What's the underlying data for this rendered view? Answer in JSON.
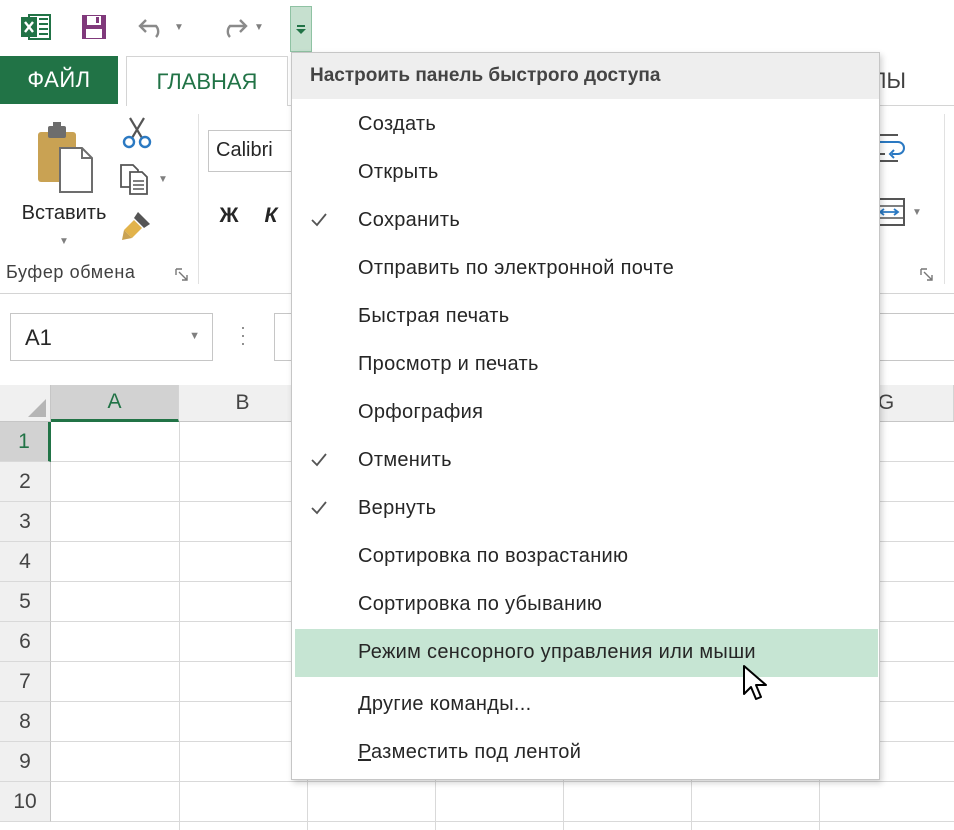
{
  "quick_access": {
    "app_icon": "excel-icon",
    "save_icon": "save-icon",
    "undo_icon": "undo-icon",
    "redo_icon": "redo-icon",
    "customize_icon": "customize-qat-icon"
  },
  "tabs": {
    "file": "ФАЙЛ",
    "home": "ГЛАВНАЯ",
    "formulas_tail": "ЛЫ"
  },
  "ribbon": {
    "paste_label": "Вставить",
    "clipboard_group": "Буфер обмена",
    "font_name": "Calibri",
    "bold": "Ж",
    "italic": "К"
  },
  "formula_bar": {
    "name_box": "A1"
  },
  "grid": {
    "columns": [
      "A",
      "B",
      "",
      "",
      "",
      "",
      "G"
    ],
    "rows": [
      "1",
      "2",
      "3",
      "4",
      "5",
      "6",
      "7",
      "8",
      "9",
      "10"
    ],
    "active_column": "A",
    "active_row": "1"
  },
  "qat_menu": {
    "header": "Настроить панель быстрого доступа",
    "items": [
      {
        "label": "Создать",
        "checked": false
      },
      {
        "label": "Открыть",
        "checked": false
      },
      {
        "label": "Сохранить",
        "checked": true
      },
      {
        "label": "Отправить по электронной почте",
        "checked": false
      },
      {
        "label": "Быстрая печать",
        "checked": false
      },
      {
        "label": "Просмотр и печать",
        "checked": false
      },
      {
        "label": "Орфография",
        "checked": false
      },
      {
        "label": "Отменить",
        "checked": true
      },
      {
        "label": "Вернуть",
        "checked": true
      },
      {
        "label": "Сортировка по возрастанию",
        "checked": false
      },
      {
        "label": "Сортировка по убыванию",
        "checked": false
      },
      {
        "label": "Режим сенсорного управления или мыши",
        "checked": false,
        "highlighted": true
      }
    ],
    "more_commands_first": "Д",
    "more_commands_rest": "ругие команды...",
    "place_below_first": "Р",
    "place_below_rest": "азместить под лентой"
  },
  "colors": {
    "excel_green": "#217346",
    "menu_highlight": "#c6e5d3",
    "save_purple": "#80397b"
  }
}
